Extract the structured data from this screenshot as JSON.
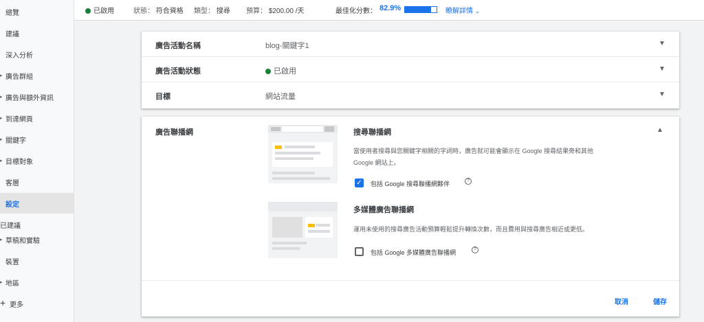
{
  "sidebar": {
    "items": [
      {
        "label": "總覽",
        "arrow": false
      },
      {
        "label": "建議",
        "arrow": false
      },
      {
        "label": "深入分析",
        "arrow": false
      },
      {
        "label": "廣告群組",
        "arrow": true
      },
      {
        "label": "廣告與額外資訊",
        "arrow": true
      },
      {
        "label": "到達網頁",
        "arrow": true
      },
      {
        "label": "關鍵字",
        "arrow": true
      },
      {
        "label": "目標對象",
        "arrow": true
      },
      {
        "label": "客層",
        "arrow": false
      },
      {
        "label": "設定",
        "arrow": false,
        "active": true
      }
    ],
    "section_label": "已建議",
    "items2": [
      {
        "label": "草稿和實驗",
        "arrow": true
      },
      {
        "label": "裝置",
        "arrow": false
      },
      {
        "label": "地區",
        "arrow": true
      }
    ],
    "more_label": "更多"
  },
  "topbar": {
    "status": "已啟用",
    "status_label": "狀態：",
    "status_value": "符合資格",
    "type_label": "類型：",
    "type_value": "搜尋",
    "budget_label": "預算：",
    "budget_value": "$200.00 /天",
    "score_label": "最佳化分數：",
    "score_value": "82.9%",
    "score_fraction": 0.829,
    "details_link": "瞭解詳情"
  },
  "settings": {
    "rows": [
      {
        "title": "廣告活動名稱",
        "value": "blog-關鍵字1"
      },
      {
        "title": "廣告活動狀態",
        "value": "已啟用",
        "dot": true
      },
      {
        "title": "目標",
        "value": "網站流量"
      }
    ]
  },
  "networks": {
    "title": "廣告聯播網",
    "search": {
      "title": "搜尋聯播網",
      "desc_line1": "當使用者搜尋與您關鍵字相關的字詞時，廣告就可能會顯示在 Google 搜尋結果旁和其他",
      "desc_line2": "Google 網站上。",
      "checkbox_label": "包括 Google 搜尋聯播網夥伴",
      "checked": true
    },
    "display": {
      "title": "多媒體廣告聯播網",
      "desc": "運用未使用的搜尋廣告活動預算輕鬆提升轉換次數，而且費用與搜尋廣告相近或更低。",
      "checkbox_label": "包括 Google 多媒體廣告聯播網",
      "checked": false
    },
    "cancel_label": "取消",
    "save_label": "儲存"
  },
  "colors": {
    "accent": "#1a73e8",
    "enabled": "#188038",
    "highlight": "#fbbc04"
  }
}
